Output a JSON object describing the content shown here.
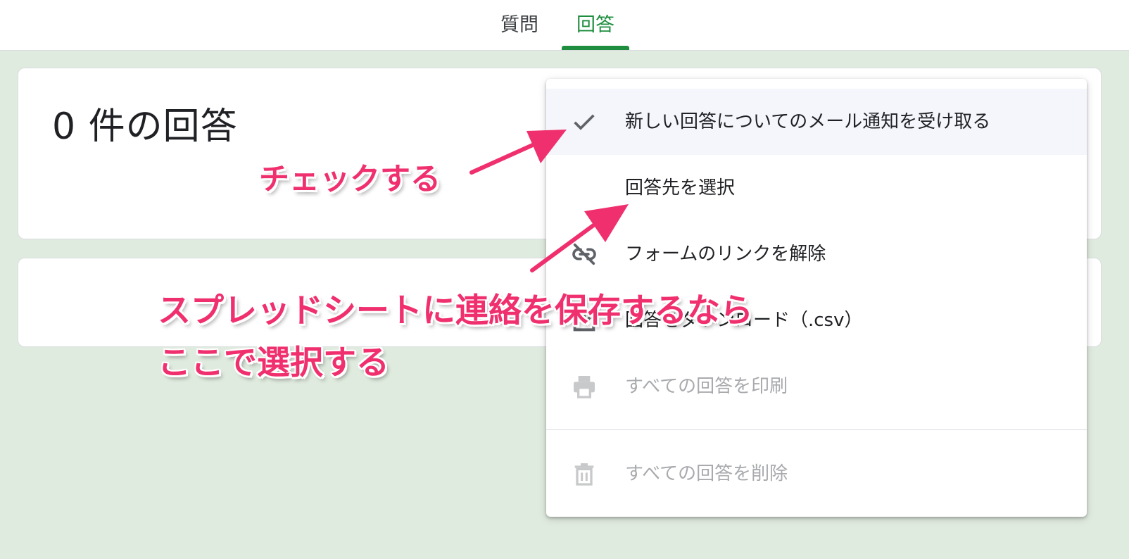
{
  "tabs": [
    {
      "label": "質問",
      "active": false
    },
    {
      "label": "回答",
      "active": true
    }
  ],
  "summary": {
    "response_count_text": "0 件の回答"
  },
  "menu": {
    "items": [
      {
        "label": "新しい回答についてのメール通知を受け取る",
        "icon": "check-icon",
        "enabled": true,
        "highlighted": true
      },
      {
        "label": "回答先を選択",
        "icon": "",
        "enabled": true
      },
      {
        "label": "フォームのリンクを解除",
        "icon": "unlink-icon",
        "enabled": true
      },
      {
        "label": "回答をダウンロード（.csv）",
        "icon": "download-icon",
        "enabled": true
      },
      {
        "label": "すべての回答を印刷",
        "icon": "print-icon",
        "enabled": false
      },
      {
        "label": "すべての回答を削除",
        "icon": "trash-icon",
        "enabled": false
      }
    ]
  },
  "annotations": {
    "check": "チェックする",
    "sheet_line1": "スプレッドシートに連絡を保存するなら",
    "sheet_line2": "ここで選択する"
  },
  "colors": {
    "background": "#e0ebdf",
    "accent_green": "#1e8e3e",
    "annotation_pink": "#f0306e",
    "disabled_text": "#a8aaad"
  }
}
